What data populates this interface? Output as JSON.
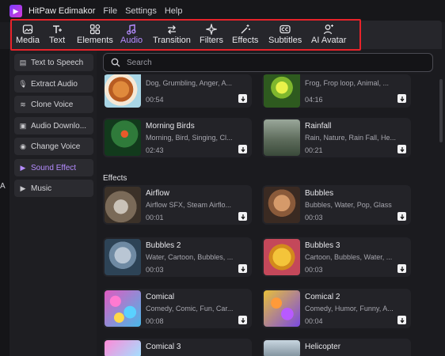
{
  "app": {
    "title": "HitPaw Edimakor",
    "menu": [
      "File",
      "Settings",
      "Help"
    ]
  },
  "toolbar": {
    "tools": [
      {
        "label": "Media",
        "icon": "image-icon"
      },
      {
        "label": "Text",
        "icon": "text-icon"
      },
      {
        "label": "Elements",
        "icon": "elements-icon"
      },
      {
        "label": "Audio",
        "icon": "music-note-icon",
        "active": true
      },
      {
        "label": "Transition",
        "icon": "transition-icon"
      },
      {
        "label": "Filters",
        "icon": "sparkle-icon"
      },
      {
        "label": "Effects",
        "icon": "wand-icon"
      },
      {
        "label": "Subtitles",
        "icon": "cc-icon"
      },
      {
        "label": "AI Avatar",
        "icon": "person-icon"
      }
    ],
    "accent": "#b58cff",
    "highlight_color": "#e8232a"
  },
  "sidebar": {
    "items": [
      {
        "label": "Text to Speech",
        "icon": "document-icon"
      },
      {
        "label": "Extract Audio",
        "icon": "microphone-icon"
      },
      {
        "label": "Clone Voice",
        "icon": "waveform-icon"
      },
      {
        "label": "Audio Downlo...",
        "icon": "download-icon"
      },
      {
        "label": "Change Voice",
        "icon": "voice-icon"
      },
      {
        "label": "Sound Effect",
        "icon": "triangle-right-icon",
        "active": true
      },
      {
        "label": "Music",
        "icon": "triangle-right-icon"
      }
    ],
    "edge_letter": "A"
  },
  "search": {
    "placeholder": "Search"
  },
  "sections": {
    "effects_title": "Effects"
  },
  "cards_top": [
    {
      "name": "",
      "tags": "Dog, Grumbling, Anger, A...",
      "duration": "00:54"
    },
    {
      "name": "",
      "tags": "Frog, Frop loop, Animal, ...",
      "duration": "04:16"
    },
    {
      "name": "Morning Birds",
      "tags": "Morning, Bird, Singing, Cl...",
      "duration": "02:43"
    },
    {
      "name": "Rainfall",
      "tags": "Rain, Nature, Rain Fall, He...",
      "duration": "00:21"
    }
  ],
  "cards_effects": [
    {
      "name": "Airflow",
      "tags": "Airflow SFX, Steam Airflo...",
      "duration": "00:01"
    },
    {
      "name": "Bubbles",
      "tags": "Bubbles, Water, Pop, Glass",
      "duration": "00:03"
    },
    {
      "name": "Bubbles 2",
      "tags": "Water, Cartoon, Bubbles, ...",
      "duration": "00:03"
    },
    {
      "name": "Bubbles 3",
      "tags": "Cartoon, Bubbles, Water, ...",
      "duration": "00:03"
    },
    {
      "name": "Comical",
      "tags": "Comedy, Comic, Fun, Car...",
      "duration": "00:08"
    },
    {
      "name": "Comical 2",
      "tags": "Comedy, Humor, Funny, A...",
      "duration": "00:04"
    },
    {
      "name": "Comical 3",
      "tags": "",
      "duration": ""
    },
    {
      "name": "Helicopter",
      "tags": "",
      "duration": ""
    }
  ]
}
